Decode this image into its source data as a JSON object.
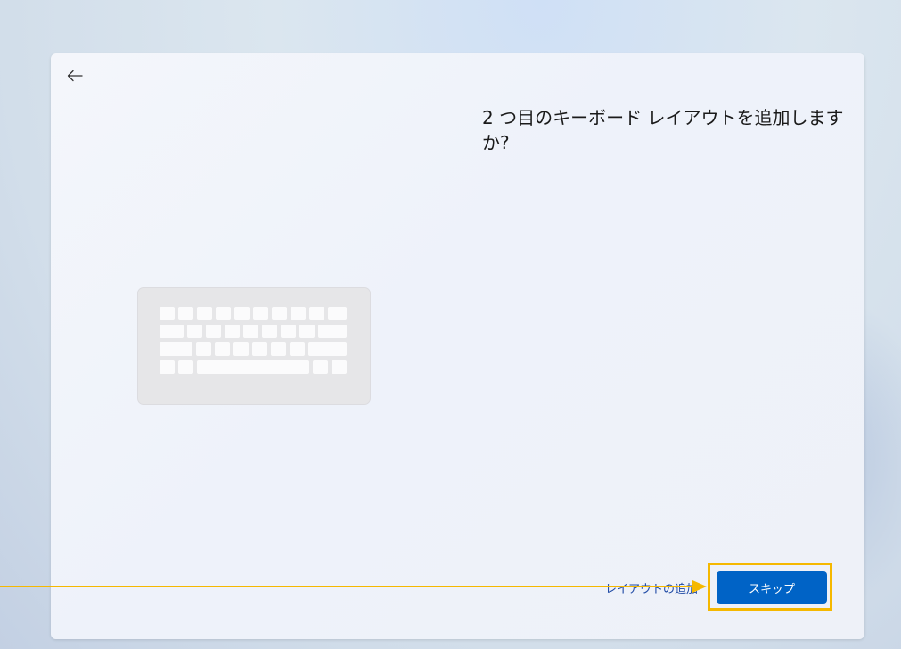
{
  "dialog": {
    "title": "2 つ目のキーボード レイアウトを追加しますか?",
    "back_icon": "arrow-left-icon",
    "illustration_icon": "keyboard-icon"
  },
  "actions": {
    "add_layout_label": "レイアウトの追加",
    "skip_label": "スキップ"
  },
  "colors": {
    "accent": "#0063c6",
    "highlight": "#f5b800",
    "link": "#1f4aa5"
  }
}
